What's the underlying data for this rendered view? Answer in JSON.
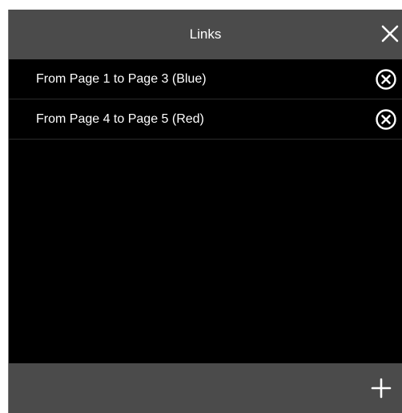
{
  "dialog": {
    "title": "Links",
    "close_icon": "close-icon",
    "add_icon": "plus-icon"
  },
  "links": [
    {
      "label": "From Page 1 to Page 3 (Blue)",
      "remove_icon": "circle-x-icon"
    },
    {
      "label": "From Page 4 to Page 5 (Red)",
      "remove_icon": "circle-x-icon"
    }
  ],
  "colors": {
    "header_bg": "#4b4b4b",
    "body_bg": "#000000",
    "text": "#ffffff"
  }
}
